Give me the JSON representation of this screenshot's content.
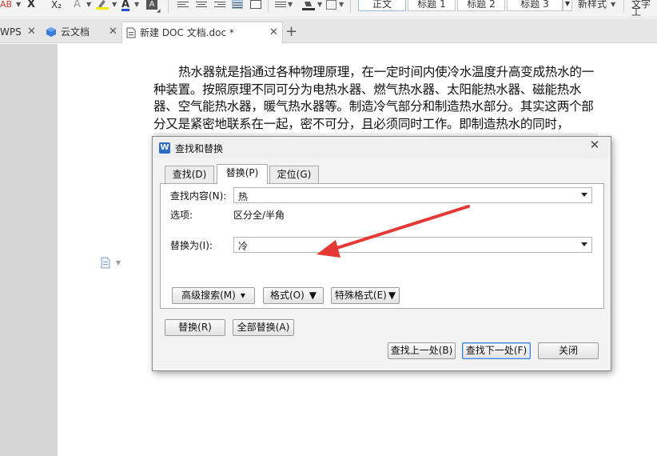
{
  "ribbon": {
    "subscript_label": "X₂",
    "strike_label": "X",
    "clear_format_label": "AB",
    "font_color_label": "A",
    "char_shade_label": "A",
    "styles": [
      "正文",
      "标题 1",
      "标题 2",
      "标题 3"
    ],
    "new_style_label": "新样式",
    "text_tools_label": "文字工",
    "accent_color": "#1e4fd8"
  },
  "tabs": [
    {
      "label": "WPS",
      "icon": "wps-icon"
    },
    {
      "label": "云文档",
      "icon": "cloud-doc-icon"
    },
    {
      "label": "新建 DOC 文档.doc *",
      "icon": "doc-file-icon",
      "active": true
    }
  ],
  "new_tab_label": "+",
  "document": {
    "paragraph": "热水器就是指通过各种物理原理，在一定时间内使冷水温度升高变成热水的一种装置。按照原理不同可分为电热水器、燃气热水器、太阳能热水器、磁能热水器、空气能热水器，暖气热水器等。制造冷气部分和制造热水部分。其实这两个部分又是紧密地联系在一起，密不可分，且必须同时工作。即制造热水的同时，"
  },
  "dialog": {
    "title": "查找和替换",
    "tabs": [
      "查找(D)",
      "替换(P)",
      "定位(G)"
    ],
    "active_tab": 1,
    "find_label": "查找内容(N):",
    "find_value": "热",
    "options_label": "选项:",
    "options_value": "区分全/半角",
    "replace_label": "替换为(I):",
    "replace_value": "冷",
    "advanced_search_label": "高级搜索(M)",
    "format_label": "格式(O)",
    "special_format_label": "特殊格式(E)",
    "replace_button": "替换(R)",
    "replace_all_button": "全部替换(A)",
    "find_prev_button": "查找上一处(B)",
    "find_next_button": "查找下一处(F)",
    "close_button": "关闭"
  },
  "annotation": {
    "arrow_color": "#e53935"
  }
}
